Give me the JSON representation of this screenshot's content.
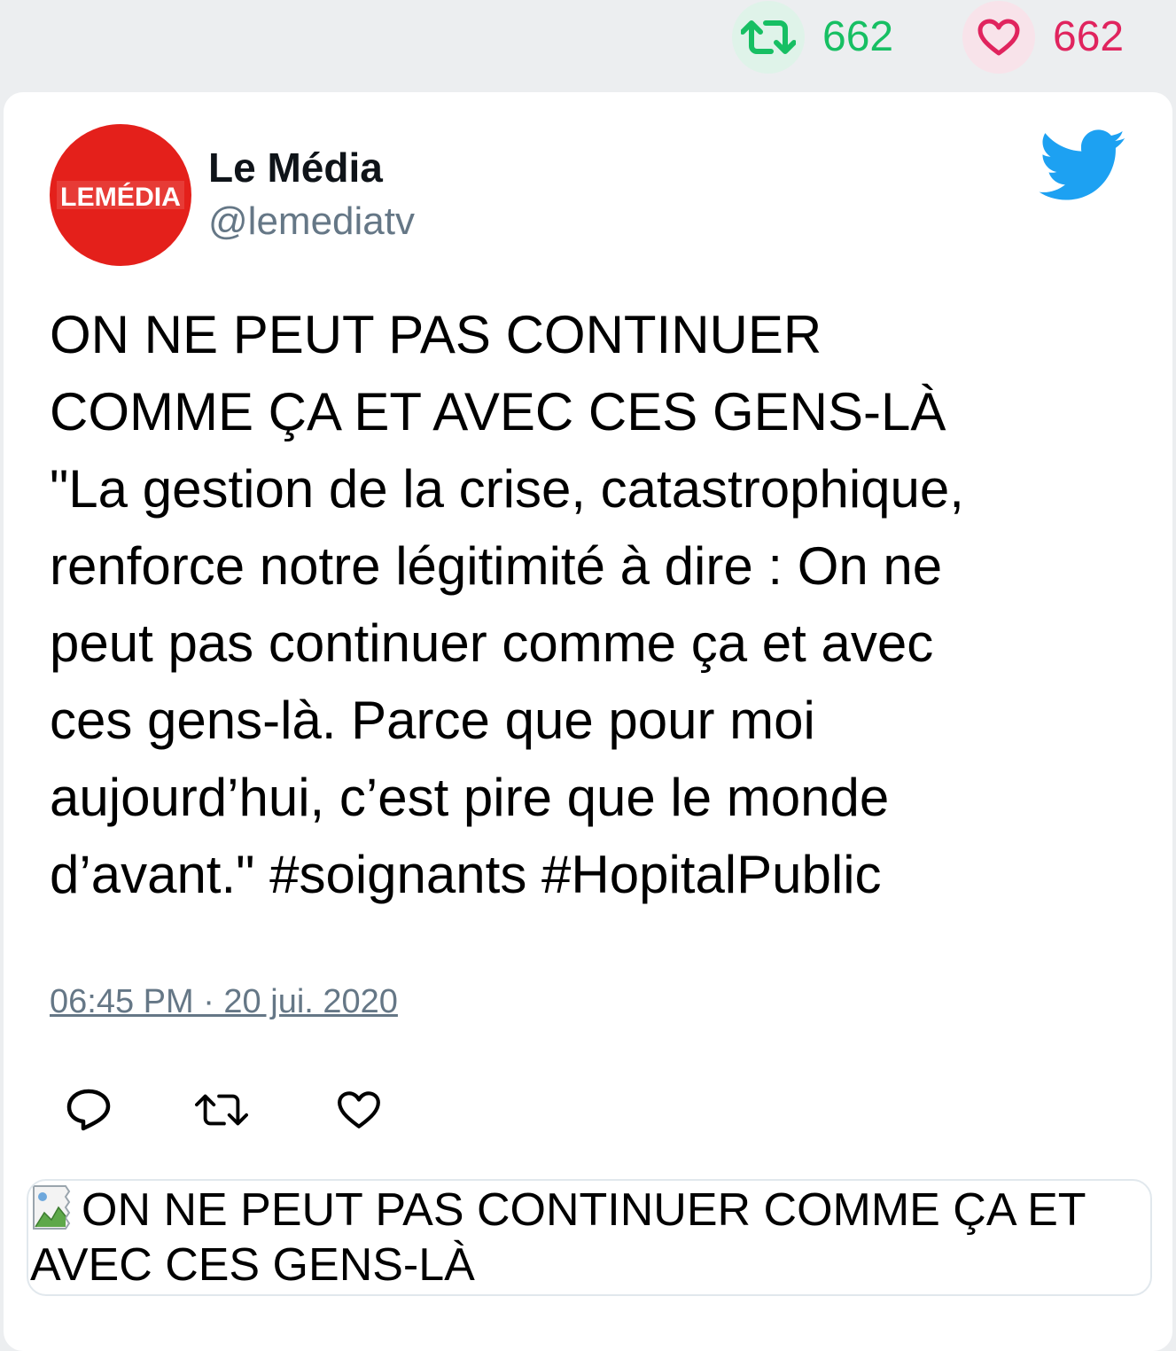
{
  "stats": {
    "retweets": "662",
    "likes": "662"
  },
  "author": {
    "name": "Le Média",
    "handle": "@lemediatv",
    "avatar_text": "LEMÉDIA"
  },
  "tweet": {
    "text": "ON NE PEUT PAS CONTINUER\nCOMME ÇA ET AVEC CES GENS-LÀ\n\"La gestion de la crise, catastrophique,\nrenforce notre légitimité à dire : On ne\npeut pas continuer comme ça et avec\nces gens-là. Parce que pour moi\naujourd’hui, c’est pire que le monde\nd’avant.\" #soignants #HopitalPublic",
    "timestamp": "06:45 PM · 20 jui. 2020"
  },
  "media": {
    "alt_text": "ON NE PEUT PAS CONTINUER COMME ÇA ET AVEC CES GENS-LÀ"
  },
  "icons": {
    "retweet": "retweet-icon",
    "like": "heart-icon",
    "reply": "reply-icon",
    "brand": "twitter-bird-icon"
  },
  "colors": {
    "retweet": "#17bf63",
    "like": "#e0245e",
    "twitter": "#1da1f2",
    "avatar_bg": "#e4201b",
    "muted": "#657786"
  }
}
